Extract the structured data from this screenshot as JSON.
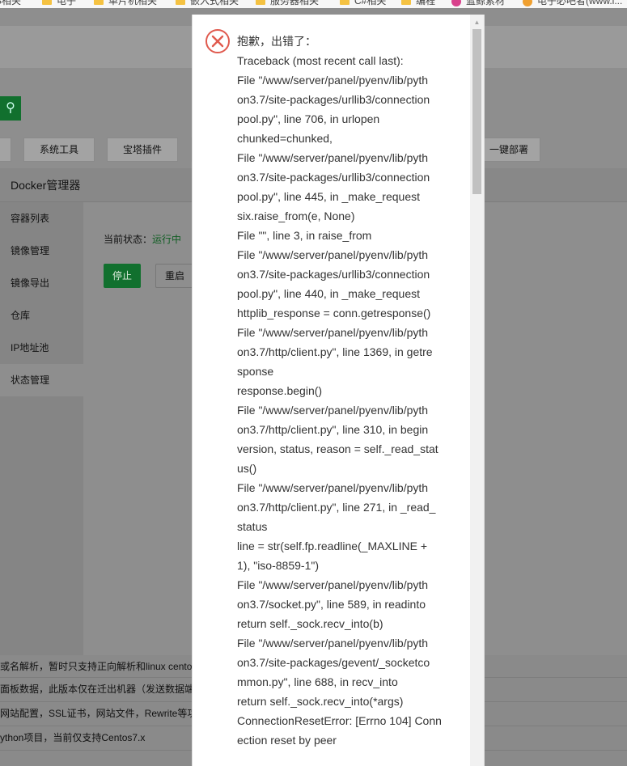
{
  "bookmarks": [
    {
      "label": "S相关",
      "icon": "folder-icon",
      "color": "#f5c242"
    },
    {
      "label": "电子",
      "icon": "folder-icon",
      "color": "#f5c242"
    },
    {
      "label": "单片机相关",
      "icon": "folder-icon",
      "color": "#f5c242"
    },
    {
      "label": "嵌入式相关",
      "icon": "folder-icon",
      "color": "#f5c242"
    },
    {
      "label": "服务器相关",
      "icon": "folder-icon",
      "color": "#f5c242"
    },
    {
      "label": "C#相关",
      "icon": "folder-icon",
      "color": "#f5c242"
    },
    {
      "label": "编程",
      "icon": "folder-icon",
      "color": "#f5c242"
    },
    {
      "label": "蓝鲸素材",
      "icon": "site-icon",
      "color": "#d9418c"
    },
    {
      "label": "电子必吧者(www.i...",
      "icon": "site-icon",
      "color": "#f0a030"
    }
  ],
  "toolbar": {
    "items": [
      "系统工具",
      "宝塔插件",
      "一键部署"
    ]
  },
  "docker": {
    "title": "Docker管理器",
    "sidebar": [
      "容器列表",
      "镜像管理",
      "镜像导出",
      "仓库",
      "IP地址池",
      "状态管理"
    ],
    "active_index": 5,
    "status_label": "当前状态：",
    "status_value": "运行中",
    "stop_label": "停止",
    "restart_label": "重启"
  },
  "plugin_rows": [
    "或名解析，暂时只支持正向解析和linux centos",
    "面板数据，此版本仅在迁出机器（发送数据端）",
    "网站配置，SSL证书，网站文件，Rewrite等功能",
    "ython项目，当前仅支持Centos7.x"
  ],
  "dialog": {
    "icon": "error-icon",
    "accent": "#e05a4e",
    "lines": [
      "抱歉，出错了：",
      "Traceback (most recent call last):",
      "File \"/www/server/panel/pyenv/lib/pyth",
      "on3.7/site-packages/urllib3/connection",
      "pool.py\", line 706, in urlopen",
      "chunked=chunked,",
      "File \"/www/server/panel/pyenv/lib/pyth",
      "on3.7/site-packages/urllib3/connection",
      "pool.py\", line 445, in _make_request",
      "six.raise_from(e, None)",
      "File \"\", line 3, in raise_from",
      "File \"/www/server/panel/pyenv/lib/pyth",
      "on3.7/site-packages/urllib3/connection",
      "pool.py\", line 440, in _make_request",
      "httplib_response = conn.getresponse()",
      "File \"/www/server/panel/pyenv/lib/pyth",
      "on3.7/http/client.py\", line 1369, in getre",
      "sponse",
      "response.begin()",
      "File \"/www/server/panel/pyenv/lib/pyth",
      "on3.7/http/client.py\", line 310, in begin",
      "version, status, reason = self._read_stat",
      "us()",
      "File \"/www/server/panel/pyenv/lib/pyth",
      "on3.7/http/client.py\", line 271, in _read_",
      "status",
      "line = str(self.fp.readline(_MAXLINE +",
      "1), \"iso-8859-1\")",
      "File \"/www/server/panel/pyenv/lib/pyth",
      "on3.7/socket.py\", line 589, in readinto",
      "return self._sock.recv_into(b)",
      "File \"/www/server/panel/pyenv/lib/pyth",
      "on3.7/site-packages/gevent/_socketco",
      "mmon.py\", line 688, in recv_into",
      "return self._sock.recv_into(*args)",
      "ConnectionResetError: [Errno 104] Conn",
      "ection reset by peer"
    ]
  }
}
